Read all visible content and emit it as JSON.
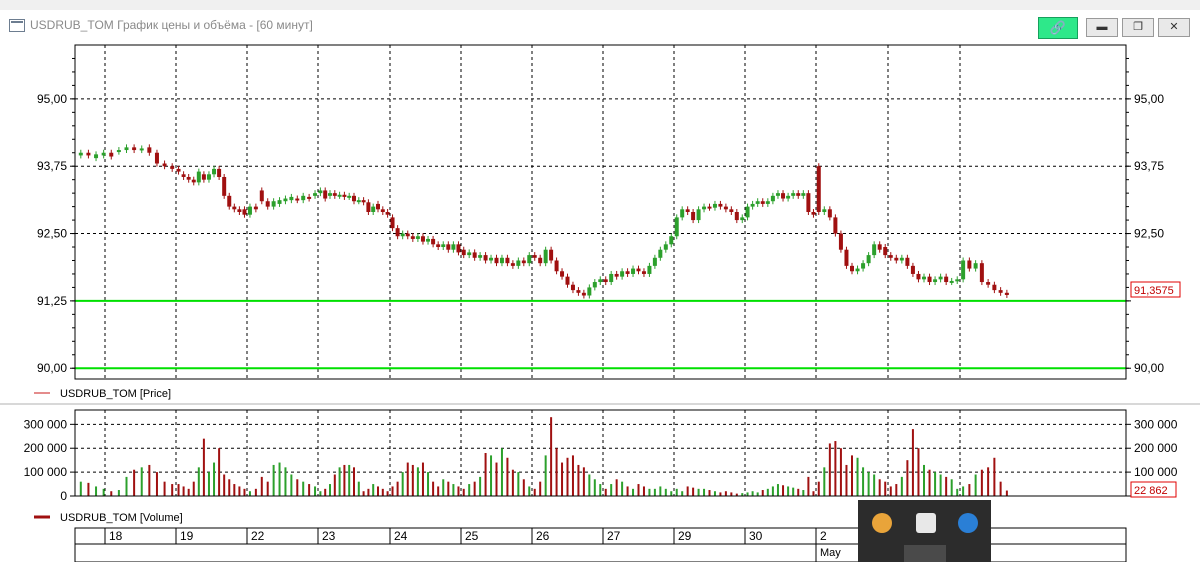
{
  "window": {
    "title": "USDRUB_TOM График цены и объёма - [60 минут]",
    "link_icon": "link-icon",
    "minimize_icon": "minimize-icon",
    "restore_icon": "restore-icon",
    "close_icon": "close-icon"
  },
  "colors": {
    "up": "#2ca02c",
    "down": "#a01010",
    "level_line": "#00e000",
    "marker_border": "#e00000",
    "grid": "#000000"
  },
  "chart_data": [
    {
      "type": "candlestick",
      "name": "price-panel",
      "ylim": [
        89.8,
        96.0
      ],
      "yticks": [
        95.0,
        93.75,
        92.5,
        91.25,
        90.0
      ],
      "ytick_labels": [
        "95,00",
        "93,75",
        "92,50",
        "91,25",
        "90,00"
      ],
      "legend": "USDRUB_TOM [Price]",
      "legend_position": "bottom-left",
      "last_value_label": "91,3575",
      "last_value": 91.3575,
      "horizontal_levels": [
        91.25,
        90.0
      ],
      "grid": true,
      "days": [
        {
          "label": "18",
          "candles": [
            [
              93.95,
              94.0
            ],
            [
              94.0,
              93.95
            ],
            [
              93.9,
              93.97
            ],
            [
              93.95,
              94.0
            ],
            [
              94.0,
              93.93
            ],
            [
              94.02,
              94.05
            ],
            [
              94.05,
              94.1
            ],
            [
              94.1,
              94.05
            ],
            [
              94.05,
              94.08
            ],
            [
              94.1,
              94.0
            ],
            [
              94.0,
              93.8
            ],
            [
              93.8,
              93.75
            ],
            [
              93.75,
              93.7
            ]
          ]
        },
        {
          "label": "19",
          "candles": [
            [
              93.7,
              93.65
            ],
            [
              93.6,
              93.55
            ],
            [
              93.55,
              93.5
            ],
            [
              93.5,
              93.45
            ],
            [
              93.45,
              93.65
            ],
            [
              93.6,
              93.5
            ],
            [
              93.5,
              93.6
            ],
            [
              93.6,
              93.7
            ],
            [
              93.7,
              93.55
            ],
            [
              93.55,
              93.2
            ],
            [
              93.2,
              93.0
            ],
            [
              93.0,
              92.95
            ],
            [
              92.95,
              92.9
            ],
            [
              92.95,
              92.85
            ]
          ]
        },
        {
          "label": "22",
          "candles": [
            [
              92.85,
              93.0
            ],
            [
              93.0,
              92.95
            ],
            [
              93.3,
              93.1
            ],
            [
              93.1,
              93.0
            ],
            [
              93.0,
              93.1
            ],
            [
              93.05,
              93.12
            ],
            [
              93.1,
              93.15
            ],
            [
              93.12,
              93.18
            ],
            [
              93.15,
              93.12
            ],
            [
              93.12,
              93.2
            ],
            [
              93.18,
              93.15
            ],
            [
              93.2,
              93.25
            ]
          ]
        },
        {
          "label": "23",
          "candles": [
            [
              93.25,
              93.3
            ],
            [
              93.3,
              93.15
            ],
            [
              93.2,
              93.25
            ],
            [
              93.25,
              93.2
            ],
            [
              93.2,
              93.22
            ],
            [
              93.22,
              93.18
            ],
            [
              93.18,
              93.2
            ],
            [
              93.2,
              93.1
            ],
            [
              93.1,
              93.12
            ],
            [
              93.12,
              93.08
            ],
            [
              93.08,
              92.9
            ],
            [
              92.9,
              93.0
            ],
            [
              93.05,
              92.95
            ],
            [
              92.95,
              92.9
            ],
            [
              92.9,
              92.85
            ]
          ]
        },
        {
          "label": "24",
          "candles": [
            [
              92.8,
              92.6
            ],
            [
              92.6,
              92.45
            ],
            [
              92.45,
              92.5
            ],
            [
              92.5,
              92.45
            ],
            [
              92.45,
              92.4
            ],
            [
              92.4,
              92.45
            ],
            [
              92.45,
              92.35
            ],
            [
              92.35,
              92.4
            ],
            [
              92.4,
              92.3
            ],
            [
              92.3,
              92.25
            ],
            [
              92.25,
              92.3
            ],
            [
              92.3,
              92.2
            ],
            [
              92.2,
              92.3
            ],
            [
              92.3,
              92.15
            ]
          ]
        },
        {
          "label": "25",
          "candles": [
            [
              92.2,
              92.1
            ],
            [
              92.1,
              92.15
            ],
            [
              92.15,
              92.05
            ],
            [
              92.05,
              92.1
            ],
            [
              92.1,
              92.0
            ],
            [
              92.0,
              92.05
            ],
            [
              92.05,
              91.95
            ],
            [
              91.95,
              92.05
            ],
            [
              92.05,
              91.95
            ],
            [
              91.95,
              91.9
            ],
            [
              91.9,
              92.0
            ],
            [
              92.0,
              91.95
            ],
            [
              91.95,
              92.1
            ]
          ]
        },
        {
          "label": "26",
          "candles": [
            [
              92.1,
              92.05
            ],
            [
              92.05,
              91.95
            ],
            [
              91.95,
              92.2
            ],
            [
              92.2,
              92.0
            ],
            [
              92.0,
              91.8
            ],
            [
              91.8,
              91.7
            ],
            [
              91.7,
              91.55
            ],
            [
              91.55,
              91.45
            ],
            [
              91.45,
              91.4
            ],
            [
              91.4,
              91.35
            ],
            [
              91.35,
              91.5
            ],
            [
              91.5,
              91.6
            ],
            [
              91.6,
              91.65
            ]
          ]
        },
        {
          "label": "27",
          "candles": [
            [
              91.65,
              91.6
            ],
            [
              91.6,
              91.75
            ],
            [
              91.75,
              91.7
            ],
            [
              91.7,
              91.8
            ],
            [
              91.8,
              91.75
            ],
            [
              91.75,
              91.85
            ],
            [
              91.85,
              91.8
            ],
            [
              91.8,
              91.75
            ],
            [
              91.75,
              91.9
            ],
            [
              91.9,
              92.05
            ],
            [
              92.05,
              92.2
            ],
            [
              92.2,
              92.3
            ],
            [
              92.3,
              92.45
            ]
          ]
        },
        {
          "label": "29",
          "candles": [
            [
              92.45,
              92.8
            ],
            [
              92.8,
              92.95
            ],
            [
              92.95,
              92.9
            ],
            [
              92.9,
              92.75
            ],
            [
              92.75,
              92.95
            ],
            [
              92.95,
              93.0
            ],
            [
              93.0,
              92.98
            ],
            [
              92.98,
              93.05
            ],
            [
              93.05,
              93.0
            ],
            [
              93.0,
              92.95
            ],
            [
              92.95,
              92.9
            ],
            [
              92.9,
              92.75
            ],
            [
              92.75,
              92.8
            ]
          ]
        },
        {
          "label": "30",
          "candles": [
            [
              92.8,
              93.0
            ],
            [
              93.0,
              93.05
            ],
            [
              93.05,
              93.1
            ],
            [
              93.1,
              93.05
            ],
            [
              93.05,
              93.1
            ],
            [
              93.1,
              93.2
            ],
            [
              93.2,
              93.25
            ],
            [
              93.25,
              93.15
            ],
            [
              93.15,
              93.2
            ],
            [
              93.2,
              93.25
            ],
            [
              93.25,
              93.2
            ],
            [
              93.2,
              93.25
            ],
            [
              93.25,
              92.9
            ],
            [
              92.9,
              92.85
            ]
          ]
        },
        {
          "label": "2",
          "candles": [
            [
              93.75,
              92.9
            ],
            [
              92.9,
              92.95
            ],
            [
              92.95,
              92.8
            ],
            [
              92.8,
              92.5
            ],
            [
              92.5,
              92.2
            ],
            [
              92.2,
              91.9
            ],
            [
              91.9,
              91.8
            ],
            [
              91.8,
              91.85
            ],
            [
              91.85,
              91.95
            ],
            [
              91.95,
              92.1
            ],
            [
              92.1,
              92.3
            ],
            [
              92.3,
              92.2
            ],
            [
              92.25,
              92.1
            ]
          ]
        },
        {
          "label": "",
          "candles": [
            [
              92.1,
              92.05
            ],
            [
              92.05,
              92.0
            ],
            [
              92.0,
              92.05
            ],
            [
              92.05,
              91.9
            ],
            [
              91.9,
              91.75
            ],
            [
              91.75,
              91.65
            ],
            [
              91.65,
              91.7
            ],
            [
              91.7,
              91.6
            ],
            [
              91.6,
              91.65
            ],
            [
              91.65,
              91.7
            ],
            [
              91.7,
              91.6
            ],
            [
              91.6,
              91.62
            ],
            [
              91.62,
              91.65
            ]
          ]
        },
        {
          "label": "",
          "candles": [
            [
              91.65,
              92.0
            ],
            [
              92.0,
              91.85
            ],
            [
              91.85,
              91.95
            ],
            [
              91.95,
              91.6
            ],
            [
              91.6,
              91.55
            ],
            [
              91.55,
              91.45
            ],
            [
              91.45,
              91.4
            ],
            [
              91.4,
              91.36
            ]
          ]
        }
      ]
    },
    {
      "type": "bar",
      "name": "volume-panel",
      "ylim": [
        0,
        360000
      ],
      "yticks": [
        0,
        100000,
        200000,
        300000
      ],
      "ytick_labels": [
        "0",
        "100 000",
        "200 000",
        "300 000"
      ],
      "legend": "USDRUB_TOM [Volume]",
      "legend_position": "bottom-left",
      "last_value_label": "22 862",
      "last_value": 22862,
      "grid": true,
      "days": [
        {
          "label": "18",
          "values": [
            60000,
            55000,
            40000,
            30000,
            20000,
            25000,
            80000,
            110000,
            120000,
            130000,
            100000,
            60000,
            50000
          ]
        },
        {
          "label": "19",
          "values": [
            50000,
            40000,
            30000,
            60000,
            120000,
            240000,
            100000,
            140000,
            200000,
            90000,
            70000,
            50000,
            40000,
            30000
          ]
        },
        {
          "label": "22",
          "values": [
            20000,
            30000,
            80000,
            60000,
            130000,
            140000,
            120000,
            90000,
            70000,
            60000,
            50000,
            40000
          ]
        },
        {
          "label": "23",
          "values": [
            20000,
            30000,
            50000,
            90000,
            120000,
            130000,
            130000,
            120000,
            60000,
            20000,
            30000,
            50000,
            40000,
            30000,
            20000
          ]
        },
        {
          "label": "24",
          "values": [
            40000,
            60000,
            100000,
            140000,
            130000,
            120000,
            140000,
            100000,
            60000,
            40000,
            70000,
            60000,
            50000,
            40000
          ]
        },
        {
          "label": "25",
          "values": [
            30000,
            50000,
            60000,
            80000,
            180000,
            170000,
            140000,
            200000,
            160000,
            110000,
            100000,
            70000,
            40000
          ]
        },
        {
          "label": "26",
          "values": [
            30000,
            60000,
            170000,
            330000,
            200000,
            140000,
            160000,
            170000,
            130000,
            120000,
            90000,
            70000,
            50000
          ]
        },
        {
          "label": "27",
          "values": [
            30000,
            50000,
            70000,
            60000,
            40000,
            30000,
            50000,
            40000,
            30000,
            30000,
            40000,
            30000,
            20000
          ]
        },
        {
          "label": "29",
          "values": [
            30000,
            20000,
            40000,
            35000,
            30000,
            30000,
            25000,
            20000,
            15000,
            20000,
            15000,
            10000,
            12000
          ]
        },
        {
          "label": "30",
          "values": [
            15000,
            20000,
            15000,
            25000,
            30000,
            40000,
            50000,
            45000,
            40000,
            35000,
            30000,
            25000,
            80000,
            20000
          ]
        },
        {
          "label": "2",
          "values": [
            60000,
            120000,
            220000,
            230000,
            200000,
            130000,
            170000,
            160000,
            120000,
            100000,
            90000,
            70000,
            60000
          ]
        },
        {
          "label": "",
          "values": [
            40000,
            50000,
            80000,
            150000,
            280000,
            200000,
            130000,
            110000,
            100000,
            90000,
            80000,
            70000,
            30000
          ]
        },
        {
          "label": "",
          "values": [
            40000,
            50000,
            90000,
            110000,
            120000,
            160000,
            60000,
            22862
          ]
        }
      ]
    }
  ],
  "x_axis": {
    "day_labels": [
      "18",
      "19",
      "22",
      "23",
      "24",
      "25",
      "26",
      "27",
      "29",
      "30",
      "2"
    ],
    "month_label": "May"
  },
  "tray": {
    "icons": [
      "orange-app-icon",
      "shield-icon",
      "blue-app-icon"
    ]
  }
}
